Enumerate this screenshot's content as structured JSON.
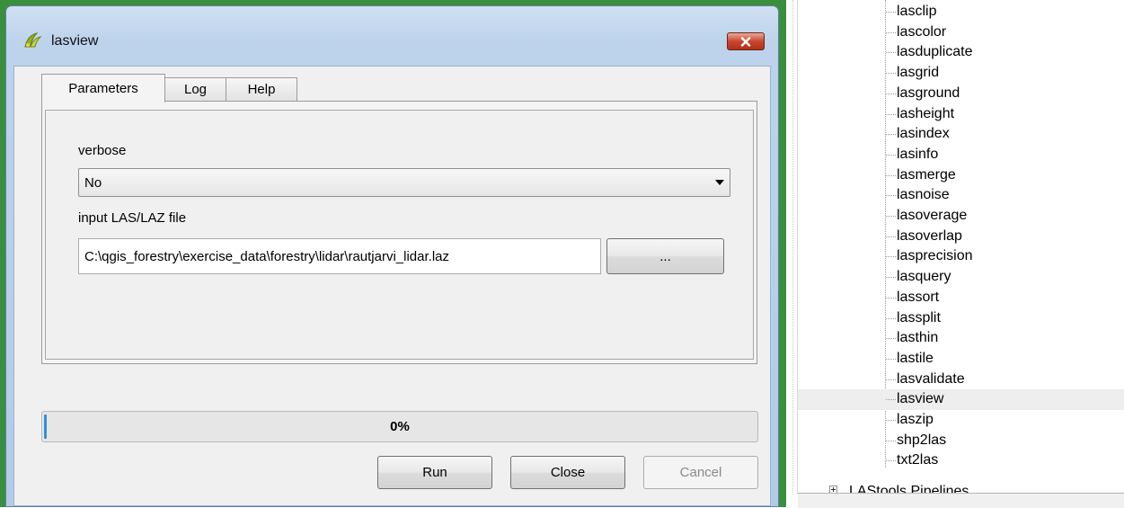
{
  "dialog": {
    "title": "lasview",
    "close_icon": "close-x-icon",
    "app_icon": "qgis-icon",
    "tabs": [
      {
        "label": "Parameters",
        "active": true
      },
      {
        "label": "Log",
        "active": false
      },
      {
        "label": "Help",
        "active": false
      }
    ],
    "params": {
      "verbose_label": "verbose",
      "verbose_value": "No",
      "input_label": "input LAS/LAZ file",
      "input_value": "C:\\qgis_forestry\\exercise_data\\forestry\\lidar\\rautjarvi_lidar.laz",
      "browse_label": "..."
    },
    "progress": {
      "text": "0%",
      "value": 0
    },
    "buttons": {
      "run": "Run",
      "close": "Close",
      "cancel": "Cancel"
    },
    "colors": {
      "accent_blue": "#2f8fe0",
      "close_red": "#c8462f",
      "window_frame": "#b3cbe8"
    }
  },
  "tree": {
    "items": [
      {
        "label": "lasclip"
      },
      {
        "label": "lascolor"
      },
      {
        "label": "lasduplicate"
      },
      {
        "label": "lasgrid"
      },
      {
        "label": "lasground"
      },
      {
        "label": "lasheight"
      },
      {
        "label": "lasindex"
      },
      {
        "label": "lasinfo"
      },
      {
        "label": "lasmerge"
      },
      {
        "label": "lasnoise"
      },
      {
        "label": "lasoverage"
      },
      {
        "label": "lasoverlap"
      },
      {
        "label": "lasprecision"
      },
      {
        "label": "lasquery"
      },
      {
        "label": "lassort"
      },
      {
        "label": "lassplit"
      },
      {
        "label": "lasthin"
      },
      {
        "label": "lastile"
      },
      {
        "label": "lasvalidate"
      },
      {
        "label": "lasview",
        "selected": true
      },
      {
        "label": "laszip"
      },
      {
        "label": "shp2las"
      },
      {
        "label": "txt2las"
      }
    ],
    "pipelines_label": "LAStools Pipelines"
  }
}
